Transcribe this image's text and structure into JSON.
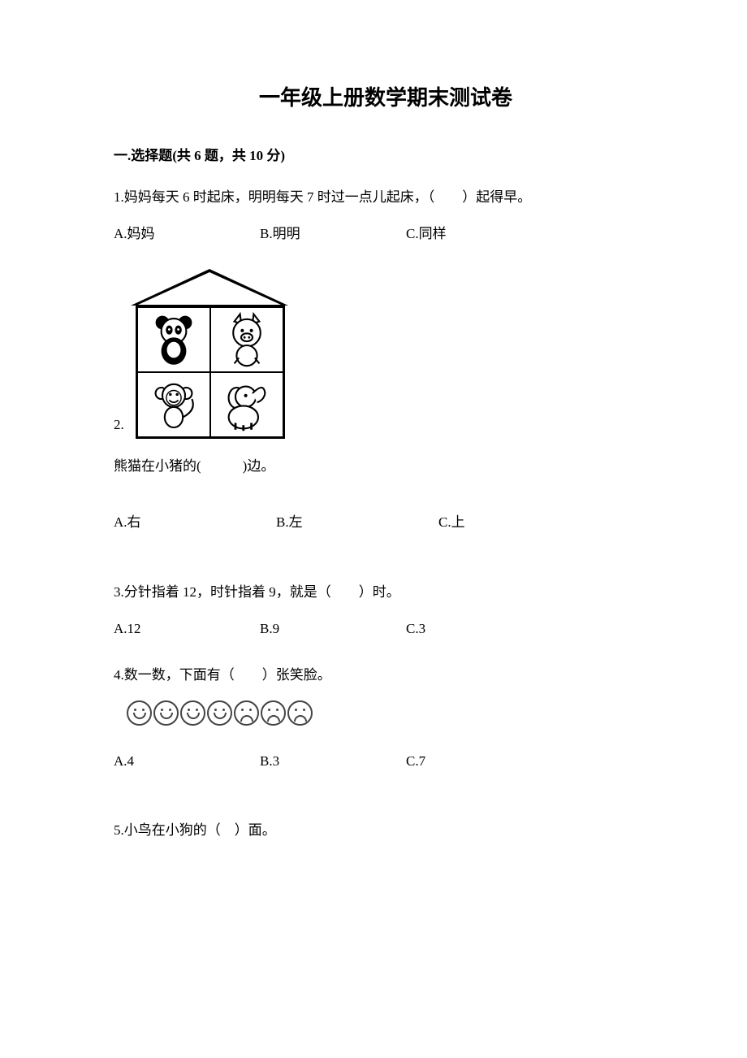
{
  "title": "一年级上册数学期末测试卷",
  "section1_header": "一.选择题(共 6 题，共 10 分)",
  "q1": {
    "text": "1.妈妈每天 6 时起床，明明每天 7 时过一点儿起床，（　　）起得早。",
    "a": "A.妈妈",
    "b": "B.明明",
    "c": "C.同样"
  },
  "q2": {
    "num": "2.",
    "text": "熊猫在小猪的(　　　)边。",
    "a": "A.右",
    "b": "B.左",
    "c": "C.上"
  },
  "q3": {
    "text": "3.分针指着 12，时针指着 9，就是（　　）时。",
    "a": "A.12",
    "b": "B.9",
    "c": "C.3"
  },
  "q4": {
    "text": "4.数一数，下面有（　　）张笑脸。",
    "a": "A.4",
    "b": "B.3",
    "c": "C.7",
    "faces": [
      "smile",
      "smile",
      "smile",
      "smile",
      "sad",
      "sad",
      "sad"
    ]
  },
  "q5": {
    "text": "5.小鸟在小狗的（　）面。"
  }
}
